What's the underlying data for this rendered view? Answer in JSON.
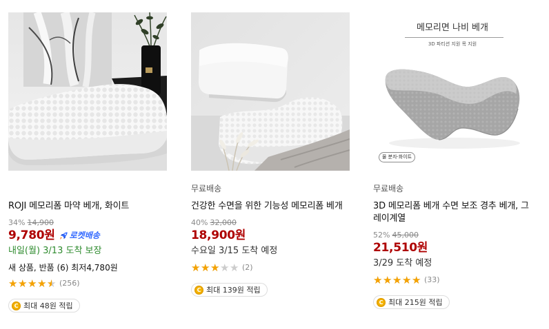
{
  "products": [
    {
      "title": "ROJI 메모리폼 마약 베개, 화이트",
      "discount_rate": "34%",
      "original_price": "14,900",
      "sale_price": "9,780원",
      "rocket_badge": "로켓배송",
      "arrival": "내일(월) 3/13 도착 보장",
      "arrival_color": "#2e8b2e",
      "extra_info": "새 상품, 반품 (6) 최저4,780원",
      "rating": 4.5,
      "review_count": "(256)",
      "reward": "최대 48원 적립"
    },
    {
      "delivery_tag": "무료배송",
      "title": "건강한 수면을 위한 기능성 메모리폼 베개",
      "discount_rate": "40%",
      "original_price": "32,000",
      "sale_price": "18,900원",
      "arrival": "수요일 3/15 도착 예정",
      "arrival_color": "#333333",
      "rating": 3,
      "review_count": "(2)",
      "reward": "최대 139원 적립"
    },
    {
      "delivery_tag": "무료배송",
      "title": "3D 메모리폼 베개 수면 보조 경추 베개, 그레이계열",
      "discount_rate": "52%",
      "original_price": "45,000",
      "sale_price": "21,510원",
      "arrival": "3/29 도착 예정",
      "arrival_color": "#333333",
      "rating": 5,
      "review_count": "(33)",
      "reward": "최대 215원 적립",
      "image_overlay": {
        "headline": "메모리면 나비 베개",
        "subheadline": "3D 파티션 지원 목 지원",
        "tag": "물 분자·화이트"
      }
    }
  ],
  "coin_icon_text": "C",
  "icons": {
    "rocket": "rocket-icon",
    "coin": "coin-icon",
    "star": "star-icon"
  },
  "colors": {
    "sale_price": "#ae0000",
    "rocket": "#346aff",
    "star": "#f5a200",
    "star_empty": "#cccccc",
    "coin": "#f5b400"
  }
}
